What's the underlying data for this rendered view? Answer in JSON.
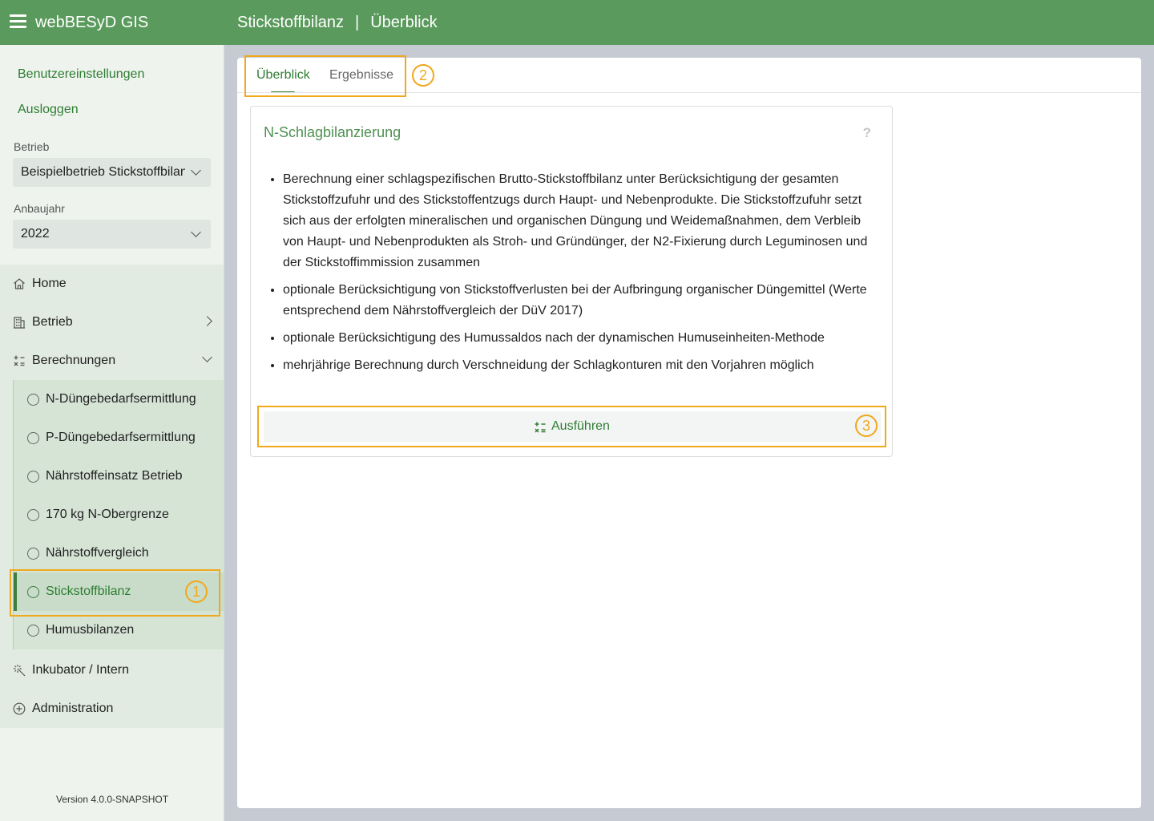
{
  "app": {
    "title": "webBESyD GIS"
  },
  "header": {
    "breadcrumb": [
      "Stickstoffbilanz",
      "Überblick"
    ],
    "separator": "|"
  },
  "sidebar": {
    "links": [
      "Benutzereinstellungen",
      "Ausloggen"
    ],
    "betrieb": {
      "label": "Betrieb",
      "value": "Beispielbetrieb Stickstoffbilanz"
    },
    "anbaujahr": {
      "label": "Anbaujahr",
      "value": "2022"
    },
    "nav": [
      {
        "label": "Home",
        "icon": "home-icon"
      },
      {
        "label": "Betrieb",
        "icon": "building-icon"
      },
      {
        "label": "Berechnungen",
        "icon": "calculator-icon"
      },
      {
        "label": "Inkubator / Intern",
        "icon": "magic-wand-icon"
      },
      {
        "label": "Administration",
        "icon": "plus-circle-icon"
      }
    ],
    "sub_nav": [
      "N-Düngebedarfsermittlung",
      "P-Düngebedarfsermittlung",
      "Nährstoffeinsatz Betrieb",
      "170 kg N-Obergrenze",
      "Nährstoffvergleich",
      "Stickstoffbilanz",
      "Humusbilanzen"
    ],
    "active_sub": "Stickstoffbilanz",
    "version": "Version 4.0.0-SNAPSHOT"
  },
  "main": {
    "tabs": [
      "Überblick",
      "Ergebnisse"
    ],
    "active_tab": "Überblick",
    "panel": {
      "title": "N-Schlagbilanzierung",
      "help": "?",
      "bullets": [
        "Berechnung einer schlagspezifischen Brutto-Stickstoffbilanz unter Berücksichtigung der gesamten Stickstoffzufuhr und des Stickstoffentzugs durch Haupt- und Nebenprodukte. Die Stickstoffzufuhr setzt sich aus der erfolgten mineralischen und organischen Düngung und Weidemaßnahmen, dem Verbleib von Haupt- und Nebenprodukten als Stroh- und Gründünger, der N2-Fixierung durch Leguminosen und der Stickstoffimmission zusammen",
        "optionale Berücksichtigung von Stickstoffverlusten bei der Aufbringung organischer Düngemittel (Werte entsprechend dem Nährstoffvergleich der DüV 2017)",
        "optionale Berücksichtigung des Humussaldos nach der dynamischen Humuseinheiten-Methode",
        "mehrjährige Berechnung durch Verschneidung der Schlagkonturen mit den Vorjahren möglich"
      ],
      "run_button": "Ausführen"
    }
  },
  "annotations": [
    "1",
    "2",
    "3"
  ],
  "colors": {
    "header": "#5a9a5c",
    "accent": "#2e7d32",
    "annotation": "#f0a81c"
  }
}
